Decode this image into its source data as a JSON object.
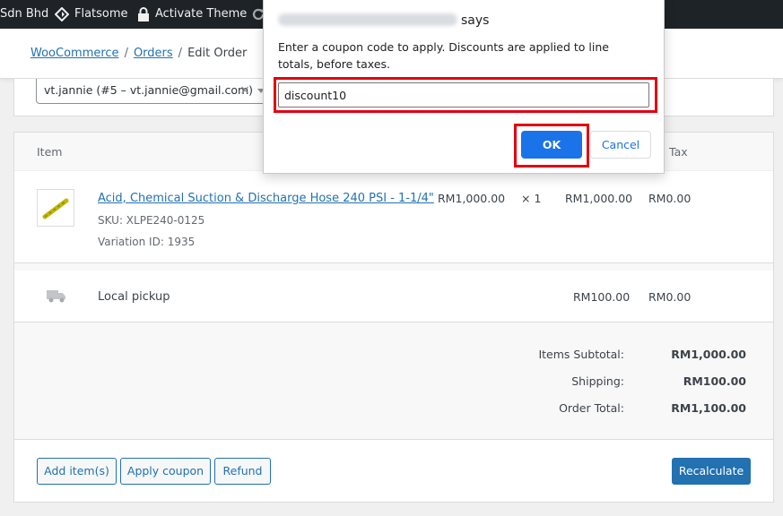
{
  "adminbar": {
    "site_name": "Sdn Bhd",
    "theme_label": "Flatsome",
    "activate_label": "Activate Theme"
  },
  "breadcrumb": {
    "woocommerce": "WooCommerce",
    "orders": "Orders",
    "current": "Edit Order"
  },
  "customer": {
    "value": "vt.jannie (#5 – vt.jannie@gmail.com)",
    "clear": "×"
  },
  "items_table": {
    "header_item": "Item",
    "header_tax": "Tax",
    "product": {
      "name": "Acid, Chemical Suction & Discharge Hose 240 PSI - 1-1/4\"",
      "sku": "SKU: XLPE240-0125",
      "variation": "Variation ID: 1935",
      "cost": "RM1,000.00",
      "qty": "× 1",
      "total": "RM1,000.00",
      "tax": "RM0.00"
    },
    "shipping": {
      "label": "Local pickup",
      "total": "RM100.00",
      "tax": "RM0.00"
    }
  },
  "totals": {
    "items_subtotal_label": "Items Subtotal:",
    "items_subtotal": "RM1,000.00",
    "shipping_label": "Shipping:",
    "shipping": "RM100.00",
    "order_total_label": "Order Total:",
    "order_total": "RM1,100.00"
  },
  "actions": {
    "add_items": "Add item(s)",
    "apply_coupon": "Apply coupon",
    "refund": "Refund",
    "recalculate": "Recalculate"
  },
  "dialog": {
    "says": "says",
    "message": "Enter a coupon code to apply. Discounts are applied to line totals, before taxes.",
    "input_value": "discount10",
    "ok": "OK",
    "cancel": "Cancel"
  },
  "colors": {
    "admin_bar": "#1d2327",
    "link": "#2271b1",
    "dialog_ok": "#1a73e8",
    "highlight": "#e3000f"
  }
}
